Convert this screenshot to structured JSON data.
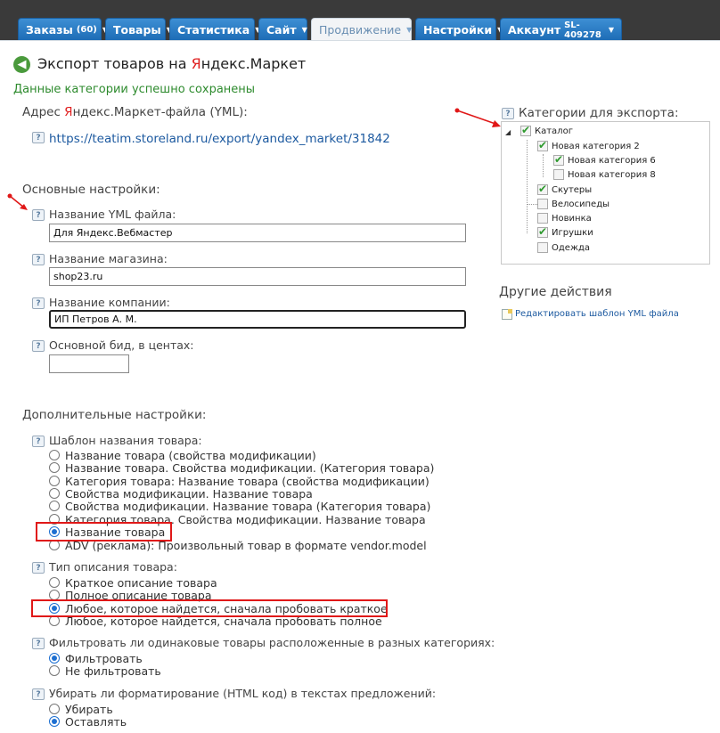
{
  "nav": {
    "tabs": [
      {
        "label": "Заказы",
        "count": "(60)"
      },
      {
        "label": "Товары"
      },
      {
        "label": "Статистика"
      },
      {
        "label": "Сайт"
      },
      {
        "label": "Продвижение"
      },
      {
        "label": "Настройки"
      },
      {
        "label": "Аккаунт",
        "count": "SL-409278"
      }
    ],
    "active_tab": "Продвижение"
  },
  "page": {
    "title_prefix": "Экспорт товаров на ",
    "title_brand_first": "Я",
    "title_brand_rest": "ндекс.Маркет",
    "success_message": "Данные категории успешно сохранены",
    "url_label_prefix": "Адрес ",
    "url_label_brand_first": "Я",
    "url_label_rest": "ндекс.Маркет-файла (YML):",
    "url": "https://teatim.storeland.ru/export/yandex_market/31842"
  },
  "main_settings": {
    "title": "Основные настройки:",
    "yml_name_label": "Название YML файла:",
    "yml_name_value": "Для Яндекс.Вебмастер",
    "shop_name_label": "Название магазина:",
    "shop_name_value": "shop23.ru",
    "company_label": "Название компании:",
    "company_value": "ИП Петров А. М.",
    "bid_label": "Основной бид, в центах:",
    "bid_value": ""
  },
  "extra_settings": {
    "title": "Дополнительные настройки:",
    "name_template_label": "Шаблон названия товара:",
    "name_template_options": [
      "Название товара (свойства модификации)",
      "Название товара. Свойства модификации. (Категория товара)",
      "Категория товара: Название товара (свойства модификации)",
      "Свойства модификации. Название товара",
      "Свойства модификации. Название товара (Категория товара)",
      "Категория товара. Свойства модификации. Название товара",
      "Название товара",
      "ADV (реклама): Произвольный товар в формате vendor.model"
    ],
    "name_template_selected": 6,
    "desc_type_label": "Тип описания товара:",
    "desc_type_options": [
      "Краткое описание товара",
      "Полное описание товара",
      "Любое, которое найдется, сначала пробовать краткое",
      "Любое, которое найдется, сначала пробовать полное"
    ],
    "desc_type_selected": 2,
    "filter_label": "Фильтровать ли одинаковые товары расположенные в разных категориях:",
    "filter_options": [
      "Фильтровать",
      "Не фильтровать"
    ],
    "filter_selected": 0,
    "html_label": "Убирать ли форматирование (HTML код) в текстах предложений:",
    "html_options": [
      "Убирать",
      "Оставлять"
    ],
    "html_selected": 1
  },
  "categories": {
    "title": "Категории для экспорта:",
    "nodes": [
      {
        "label": "Каталог",
        "checked": true
      },
      {
        "label": "Новая категория 2",
        "checked": true
      },
      {
        "label": "Новая категория 6",
        "checked": true
      },
      {
        "label": "Новая категория 8",
        "checked": false
      },
      {
        "label": "Скутеры",
        "checked": true
      },
      {
        "label": "Велосипеды",
        "checked": false
      },
      {
        "label": "Новинка",
        "checked": false
      },
      {
        "label": "Игрушки",
        "checked": true
      },
      {
        "label": "Одежда",
        "checked": false
      }
    ]
  },
  "other_actions": {
    "title": "Другие действия",
    "edit_template_link": "Редактировать шаблон YML файла"
  },
  "help_glyph": "?",
  "colors": {
    "tab_blue": "#1c6bb5",
    "success_green": "#2e8b2e",
    "annotation_red": "#e01818",
    "link_blue": "#1d5aa0"
  }
}
